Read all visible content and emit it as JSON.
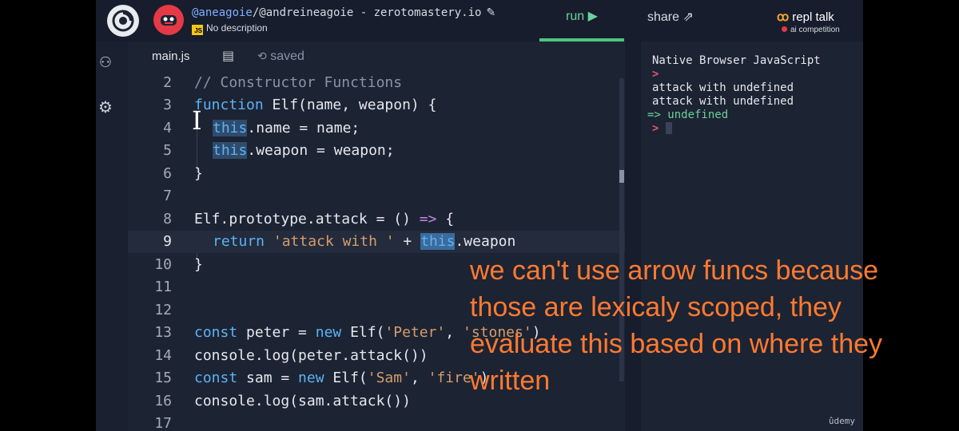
{
  "header": {
    "repl_owner": "@aneagoie",
    "repl_name": "/@andreineagoie - zerotomastery.io",
    "description_badge": "JS",
    "description": "No description",
    "run_label": "run",
    "share_label": "share",
    "talk_label": "repl talk",
    "talk_sub": "ai competition"
  },
  "tabs": {
    "file": "main.js",
    "saved": "saved"
  },
  "editor": {
    "active_line": 9,
    "line_numbers": [
      "2",
      "3",
      "4",
      "5",
      "6",
      "7",
      "8",
      "9",
      "10",
      "11",
      "12",
      "13",
      "14",
      "15",
      "16",
      "17"
    ]
  },
  "code": {
    "l2": "// Constructor Functions",
    "l3_kw": "function",
    "l3_rest": " Elf(name, weapon) {",
    "l4_this": "this",
    "l4_rest": ".name = name;",
    "l5_this": "this",
    "l5_rest": ".weapon = weapon;",
    "l6": "}",
    "l8_a": "Elf.prototype.attack = () ",
    "l8_arrow": "=>",
    "l8_b": " {",
    "l9_kw": "return",
    "l9_str": "'attack with '",
    "l9_plus": " + ",
    "l9_this": "this",
    "l9_rest": ".weapon",
    "l10": "}",
    "l13_kw": "const",
    "l13_a": " peter = ",
    "l13_new": "new",
    "l13_b": " Elf(",
    "l13_s1": "'Peter'",
    "l13_c": ", ",
    "l13_s2": "'stones'",
    "l13_d": ")",
    "l14": "console.log(peter.attack())",
    "l15_kw": "const",
    "l15_a": " sam = ",
    "l15_new": "new",
    "l15_b": " Elf(",
    "l15_s1": "'Sam'",
    "l15_c": ", ",
    "l15_s2": "'fire'",
    "l15_d": ")",
    "l16": "console.log(sam.attack())"
  },
  "console": {
    "header": "Native Browser JavaScript",
    "prompt_symbol": ">",
    "out1": "attack with undefined",
    "out2": "attack with undefined",
    "result": "=> undefined"
  },
  "caption": {
    "line1": "we can't use arrow funcs because",
    "line2": "those are lexicaly scoped, they",
    "line3": "evaluate this based on where they",
    "line4": "written"
  },
  "watermark": "ûdemy",
  "colors": {
    "run_green": "#4ec67e",
    "caption_orange": "#ff7a2f",
    "keyword_blue": "#5cb3f5",
    "string_orange": "#d79c6b"
  }
}
